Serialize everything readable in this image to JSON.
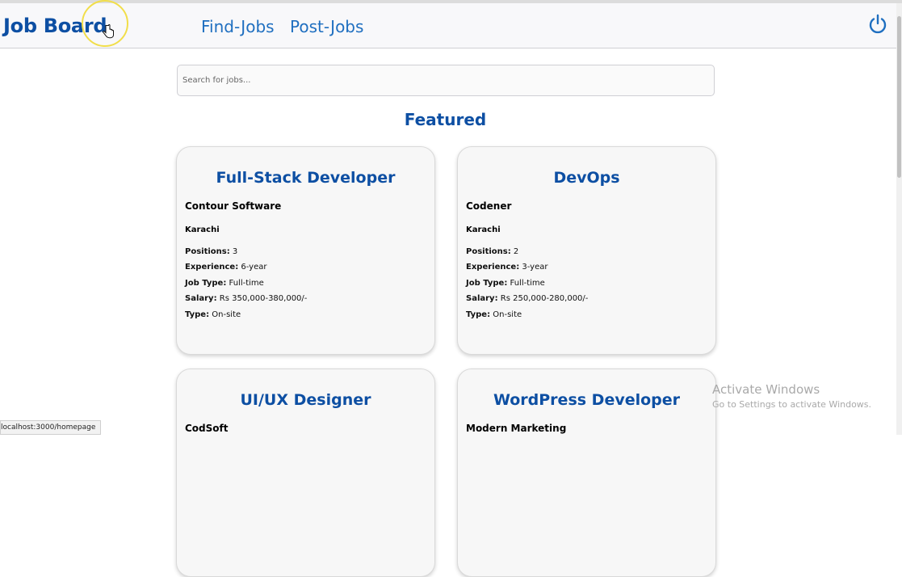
{
  "navbar": {
    "brand": "Job Board",
    "links": [
      "Find-Jobs",
      "Post-Jobs"
    ],
    "power_icon": "power-icon"
  },
  "search": {
    "placeholder": "Search for jobs..."
  },
  "section_title": "Featured",
  "labels": {
    "positions": "Positions:",
    "experience": "Experience:",
    "job_type": "Job Type:",
    "salary": "Salary:",
    "type": "Type:"
  },
  "jobs": [
    {
      "title": "Full-Stack Developer",
      "company": "Contour Software",
      "city": "Karachi",
      "positions": "3",
      "experience": "6-year",
      "job_type": "Full-time",
      "salary": "Rs 350,000-380,000/-",
      "type": "On-site"
    },
    {
      "title": "DevOps",
      "company": "Codener",
      "city": "Karachi",
      "positions": "2",
      "experience": "3-year",
      "job_type": "Full-time",
      "salary": "Rs 250,000-280,000/-",
      "type": "On-site"
    },
    {
      "title": "UI/UX Designer",
      "company": "CodSoft"
    },
    {
      "title": "WordPress Developer",
      "company": "Modern Marketing"
    }
  ],
  "status_bar": {
    "url": "localhost:3000/homepage"
  },
  "watermark": {
    "line1": "Activate Windows",
    "line2": "Go to Settings to activate Windows."
  },
  "colors": {
    "accent": "#0d4fa3",
    "link": "#1f6fc0",
    "highlight_ring": "#f1de4a"
  }
}
